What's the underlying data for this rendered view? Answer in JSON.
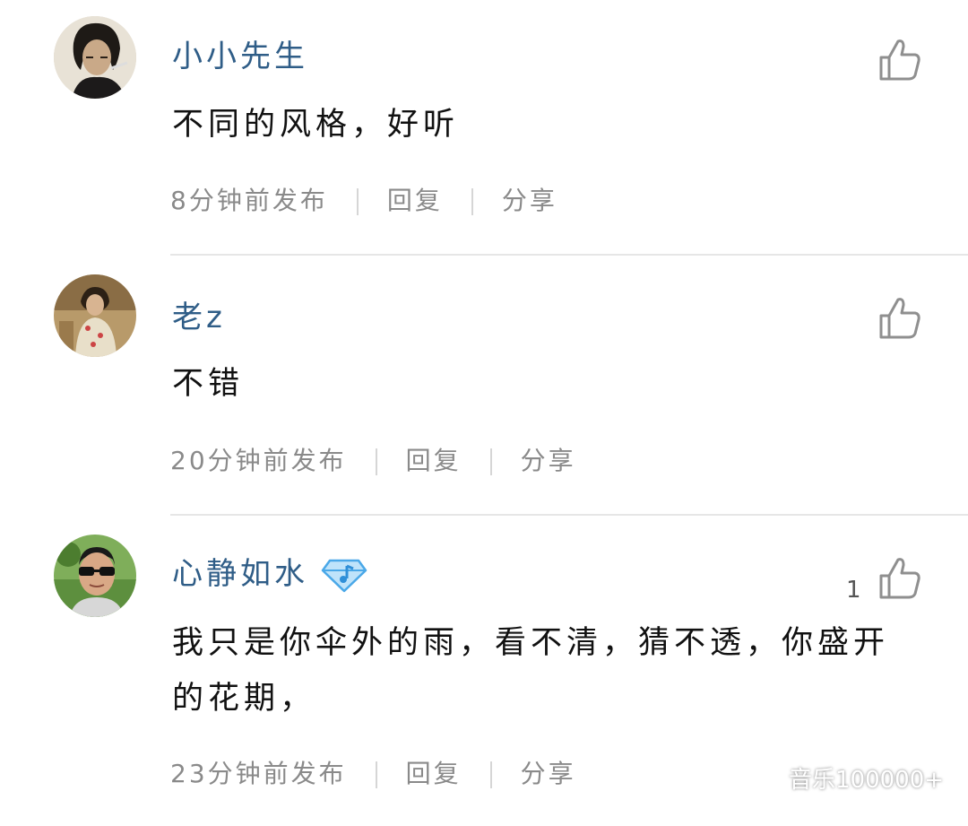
{
  "comments": [
    {
      "username": "小小先生",
      "content": "不同的风格，好听",
      "time": "8分钟前发布",
      "reply_label": "回复",
      "share_label": "分享",
      "likes": ""
    },
    {
      "username": "老z",
      "content": "不错",
      "time": "20分钟前发布",
      "reply_label": "回复",
      "share_label": "分享",
      "likes": ""
    },
    {
      "username": "心静如水",
      "content": "我只是你伞外的雨，看不清，猜不透，你盛开的花期，",
      "time": "23分钟前发布",
      "reply_label": "回复",
      "share_label": "分享",
      "likes": "1"
    }
  ],
  "watermark": {
    "text": "音乐100000+"
  },
  "colors": {
    "username": "#2f5d87",
    "content": "#111111",
    "meta": "#8a8a8a",
    "divider": "#e6e6e6",
    "vip_badge": "#4aa8e8"
  },
  "icons": {
    "like": "thumbs-up-icon",
    "vip": "diamond-music-badge-icon",
    "watermark": "wechat-icon"
  }
}
